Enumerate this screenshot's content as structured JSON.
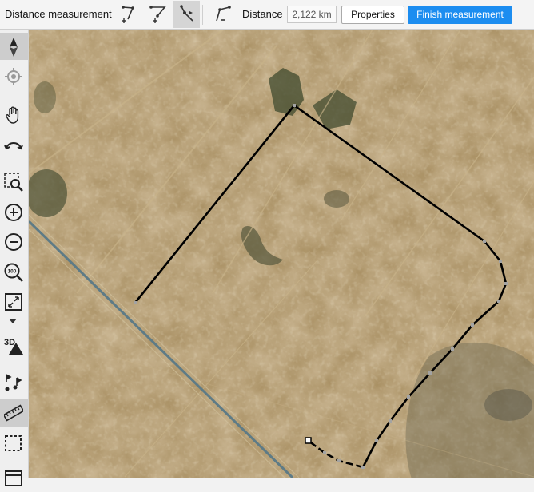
{
  "toolbar": {
    "title": "Distance measurement",
    "distance_label": "Distance",
    "distance_value": "2,122 km",
    "properties_label": "Properties",
    "finish_label": "Finish measurement",
    "tools": [
      {
        "name": "add-point-start-tool",
        "icon": "polyline-plus-icon",
        "active": false
      },
      {
        "name": "add-point-end-tool",
        "icon": "polyline-plus-icon",
        "active": false
      },
      {
        "name": "move-point-tool",
        "icon": "polyline-move-icon",
        "active": true
      },
      {
        "name": "remove-point-tool",
        "icon": "polyline-minus-icon",
        "active": false
      }
    ],
    "accent_color": "#1c8df0"
  },
  "sidebar": {
    "items": [
      {
        "name": "compass-north-button",
        "icon": "compass-icon"
      },
      {
        "name": "locate-button",
        "icon": "locate-icon"
      },
      {
        "name": "pan-button",
        "icon": "hand-icon"
      },
      {
        "name": "rotate-button",
        "icon": "rotate-icon"
      },
      {
        "name": "zoom-area-button",
        "icon": "zoom-area-icon"
      },
      {
        "name": "zoom-in-button",
        "icon": "zoom-in-icon"
      },
      {
        "name": "zoom-out-button",
        "icon": "zoom-out-icon"
      },
      {
        "name": "zoom-100-button",
        "icon": "zoom-100-icon"
      },
      {
        "name": "fit-extent-button",
        "icon": "fit-extent-icon"
      },
      {
        "name": "three-d-button",
        "icon": "three-d-icon",
        "label": "3D"
      },
      {
        "name": "route-button",
        "icon": "route-flag-icon"
      },
      {
        "name": "measure-button",
        "icon": "ruler-icon",
        "active": true
      },
      {
        "name": "select-area-button",
        "icon": "select-rect-icon"
      },
      {
        "name": "more-button",
        "icon": "panel-icon"
      }
    ]
  },
  "map": {
    "measurement_line_color": "#000000",
    "vertex_color": "#9a9a9a"
  }
}
